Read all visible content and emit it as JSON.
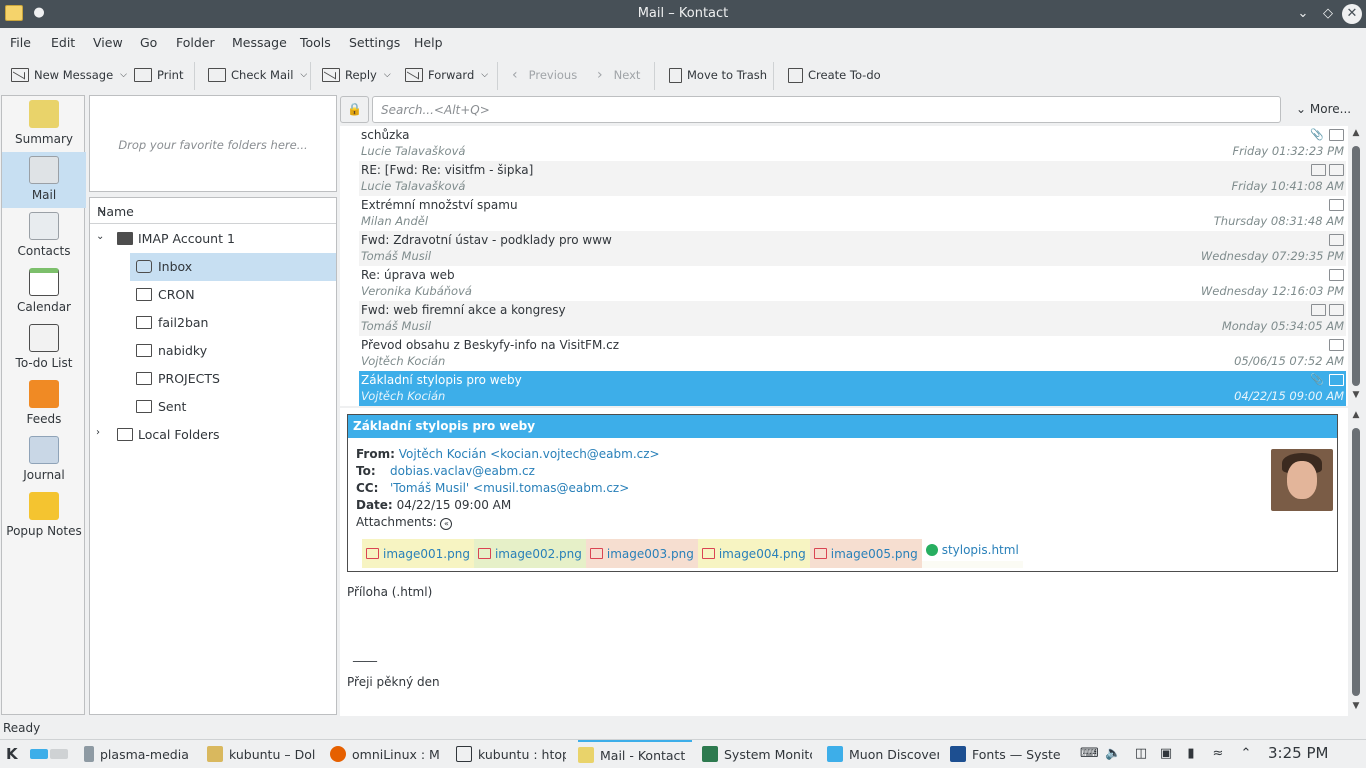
{
  "window": {
    "title": "Mail – Kontact"
  },
  "menu": [
    "File",
    "Edit",
    "View",
    "Go",
    "Folder",
    "Message",
    "Tools",
    "Settings",
    "Help"
  ],
  "toolbar": {
    "new_message": "New Message",
    "print": "Print",
    "check_mail": "Check Mail",
    "reply": "Reply",
    "forward": "Forward",
    "previous": "Previous",
    "next": "Next",
    "move_to_trash": "Move to Trash",
    "create_todo": "Create To-do"
  },
  "sidebar": {
    "items": [
      {
        "label": "Summary",
        "icon": "summary-icon",
        "color": "#e9d36a"
      },
      {
        "label": "Mail",
        "icon": "mail-icon",
        "color": "#dfe3e6"
      },
      {
        "label": "Contacts",
        "icon": "contacts-icon",
        "color": "#e8ecef"
      },
      {
        "label": "Calendar",
        "icon": "calendar-icon",
        "color": "#7cbf6b"
      },
      {
        "label": "To-do List",
        "icon": "todo-icon",
        "color": "#f2f2f2"
      },
      {
        "label": "Feeds",
        "icon": "feeds-icon",
        "color": "#f08a24"
      },
      {
        "label": "Journal",
        "icon": "journal-icon",
        "color": "#c9d7e6"
      },
      {
        "label": "Popup Notes",
        "icon": "notes-icon",
        "color": "#f4c430"
      }
    ]
  },
  "favorites": {
    "placeholder": "Drop your favorite folders here..."
  },
  "folders": {
    "header": "Name",
    "account": "IMAP Account 1",
    "items": [
      "Inbox",
      "CRON",
      "fail2ban",
      "nabidky",
      "PROJECTS",
      "Sent"
    ],
    "local": "Local Folders"
  },
  "search": {
    "placeholder": "Search...<Alt+Q>",
    "more": "More..."
  },
  "messages": [
    {
      "subject": "schůzka",
      "from": "Lucie Talavašková",
      "date": "Friday 01:32:23 PM"
    },
    {
      "subject": "RE: [Fwd: Re: visitfm - šipka]",
      "from": "Lucie Talavašková",
      "date": "Friday 10:41:08 AM"
    },
    {
      "subject": "Extrémní množství spamu",
      "from": "Milan Anděl",
      "date": "Thursday 08:31:48 AM"
    },
    {
      "subject": "Fwd: Zdravotní ústav - podklady pro www",
      "from": "Tomáš Musil",
      "date": "Wednesday 07:29:35 PM"
    },
    {
      "subject": "Re: úprava web",
      "from": "Veronika Kubáňová",
      "date": "Wednesday 12:16:03 PM"
    },
    {
      "subject": "Fwd: web firemní akce a kongresy",
      "from": "Tomáš Musil",
      "date": "Monday 05:34:05 AM"
    },
    {
      "subject": "Převod obsahu z Beskyfy-info na VisitFM.cz",
      "from": "Vojtěch Kocián",
      "date": "05/06/15 07:52 AM"
    },
    {
      "subject": "Základní stylopis pro weby",
      "from": "Vojtěch Kocián",
      "date": "04/22/15 09:00 AM"
    }
  ],
  "preview": {
    "subject": "Základní stylopis pro weby",
    "from_label": "From:",
    "from": "Vojtěch Kocián <kocian.vojtech@eabm.cz>",
    "to_label": "To:",
    "to": "dobias.vaclav@eabm.cz",
    "cc_label": "CC:",
    "cc": "'Tomáš Musil' <musil.tomas@eabm.cz>",
    "date_label": "Date:",
    "date": "04/22/15 09:00 AM",
    "attachments_label": "Attachments:",
    "attachments": [
      "image001.png",
      "image002.png",
      "image003.png",
      "image004.png",
      "image005.png"
    ],
    "html_attachment": "stylopis.html",
    "body_line1": "Příloha (.html)",
    "body_sep": "____",
    "body_line2": "Přeji pěkný den"
  },
  "status": {
    "text": "Ready"
  },
  "taskbar": {
    "tasks": [
      {
        "label": "plasma-media",
        "icon": "plasma-icon",
        "color": "#8e9aa3"
      },
      {
        "label": "kubuntu – Dol",
        "icon": "dolphin-icon",
        "color": "#d9b85e"
      },
      {
        "label": "omniLinux : Mi",
        "icon": "firefox-icon",
        "color": "#e66000"
      },
      {
        "label": "kubuntu : htop",
        "icon": "terminal-icon",
        "color": "#31363b"
      },
      {
        "label": "Mail - Kontact",
        "icon": "kontact-icon",
        "color": "#e9d36a"
      },
      {
        "label": "System Monito",
        "icon": "sysmon-icon",
        "color": "#2d7a4f"
      },
      {
        "label": "Muon Discover",
        "icon": "muon-icon",
        "color": "#3daee9"
      },
      {
        "label": "Fonts — Syste",
        "icon": "fonts-icon",
        "color": "#1d4f91"
      }
    ],
    "clock": "3:25 PM"
  },
  "colors": {
    "accent": "#3daee9",
    "titlebar": "#475057",
    "selection_light": "#c7dff2"
  }
}
